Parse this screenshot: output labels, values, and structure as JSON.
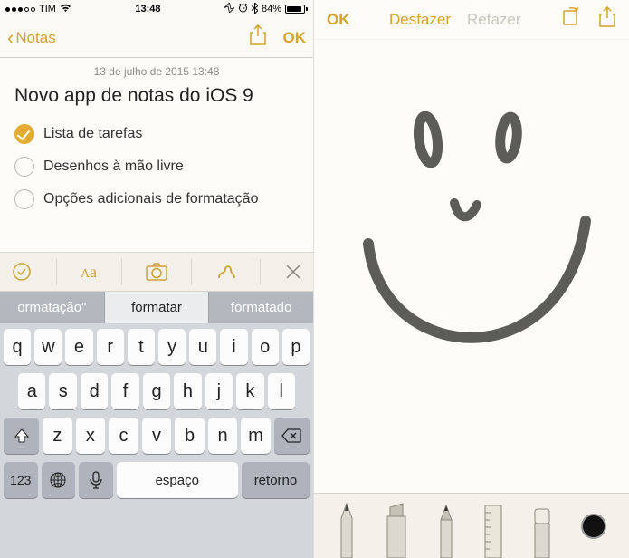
{
  "status": {
    "signal_dots_filled": 3,
    "carrier": "TIM",
    "time": "13:48",
    "battery_pct": "84%"
  },
  "left": {
    "nav_back": "Notas",
    "nav_ok": "OK",
    "note_date": "13 de julho de 2015 13:48",
    "note_title": "Novo app de notas do iOS 9",
    "checks": [
      {
        "label": "Lista de tarefas",
        "checked": true
      },
      {
        "label": "Desenhos à mão livre",
        "checked": false
      },
      {
        "label": "Opções adicionais de formatação",
        "checked": false
      }
    ],
    "format_aa": "Aa",
    "suggestions": {
      "left": "ormatação\"",
      "mid": "formatar",
      "right": "formatado"
    },
    "keyboard": {
      "row1": [
        "q",
        "w",
        "e",
        "r",
        "t",
        "y",
        "u",
        "i",
        "o",
        "p"
      ],
      "row2": [
        "a",
        "s",
        "d",
        "f",
        "g",
        "h",
        "j",
        "k",
        "l"
      ],
      "row3": [
        "z",
        "x",
        "c",
        "v",
        "b",
        "n",
        "m"
      ],
      "num": "123",
      "space": "espaço",
      "return": "retorno"
    }
  },
  "right": {
    "ok": "OK",
    "undo": "Desfazer",
    "redo": "Refazer"
  }
}
